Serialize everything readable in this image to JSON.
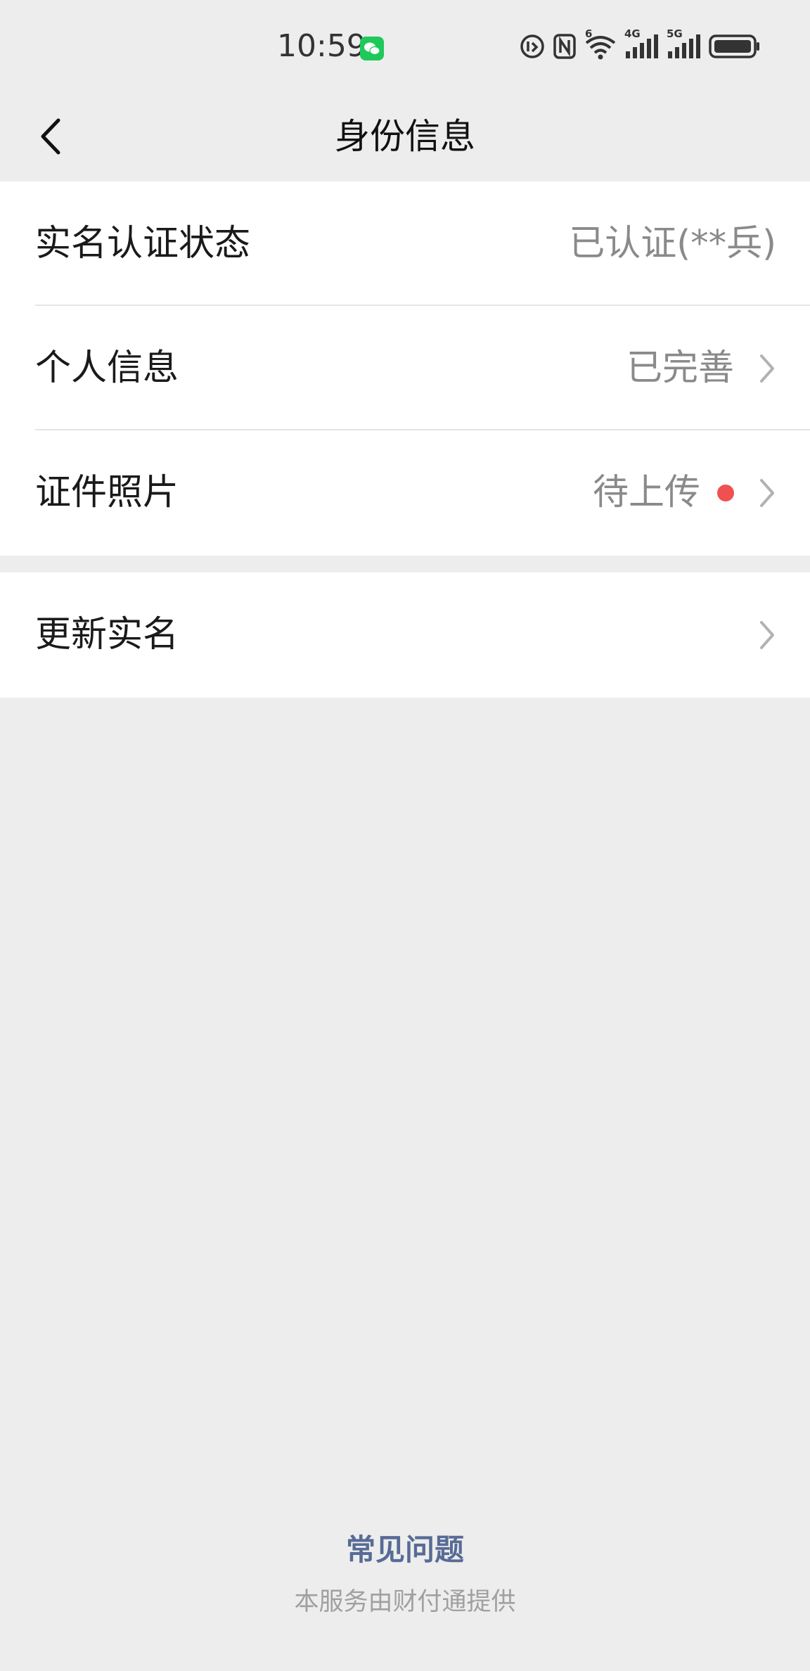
{
  "status_bar": {
    "time": "10:59",
    "network_labels": [
      "6",
      "4G",
      "5G"
    ]
  },
  "nav": {
    "title": "身份信息"
  },
  "identity_cells": [
    {
      "label": "实名认证状态",
      "value": "已认证(**兵)"
    },
    {
      "label": "个人信息",
      "value": "已完善"
    },
    {
      "label": "证件照片",
      "value": "待上传"
    }
  ],
  "update_cell": {
    "label": "更新实名"
  },
  "footer": {
    "faq": "常见问题",
    "provider": "本服务由财付通提供"
  },
  "colors": {
    "background": "#ededed",
    "cell_background": "#ffffff",
    "link": "#576b95",
    "badge_red": "#f05050",
    "wechat_green": "#1ec95a"
  }
}
